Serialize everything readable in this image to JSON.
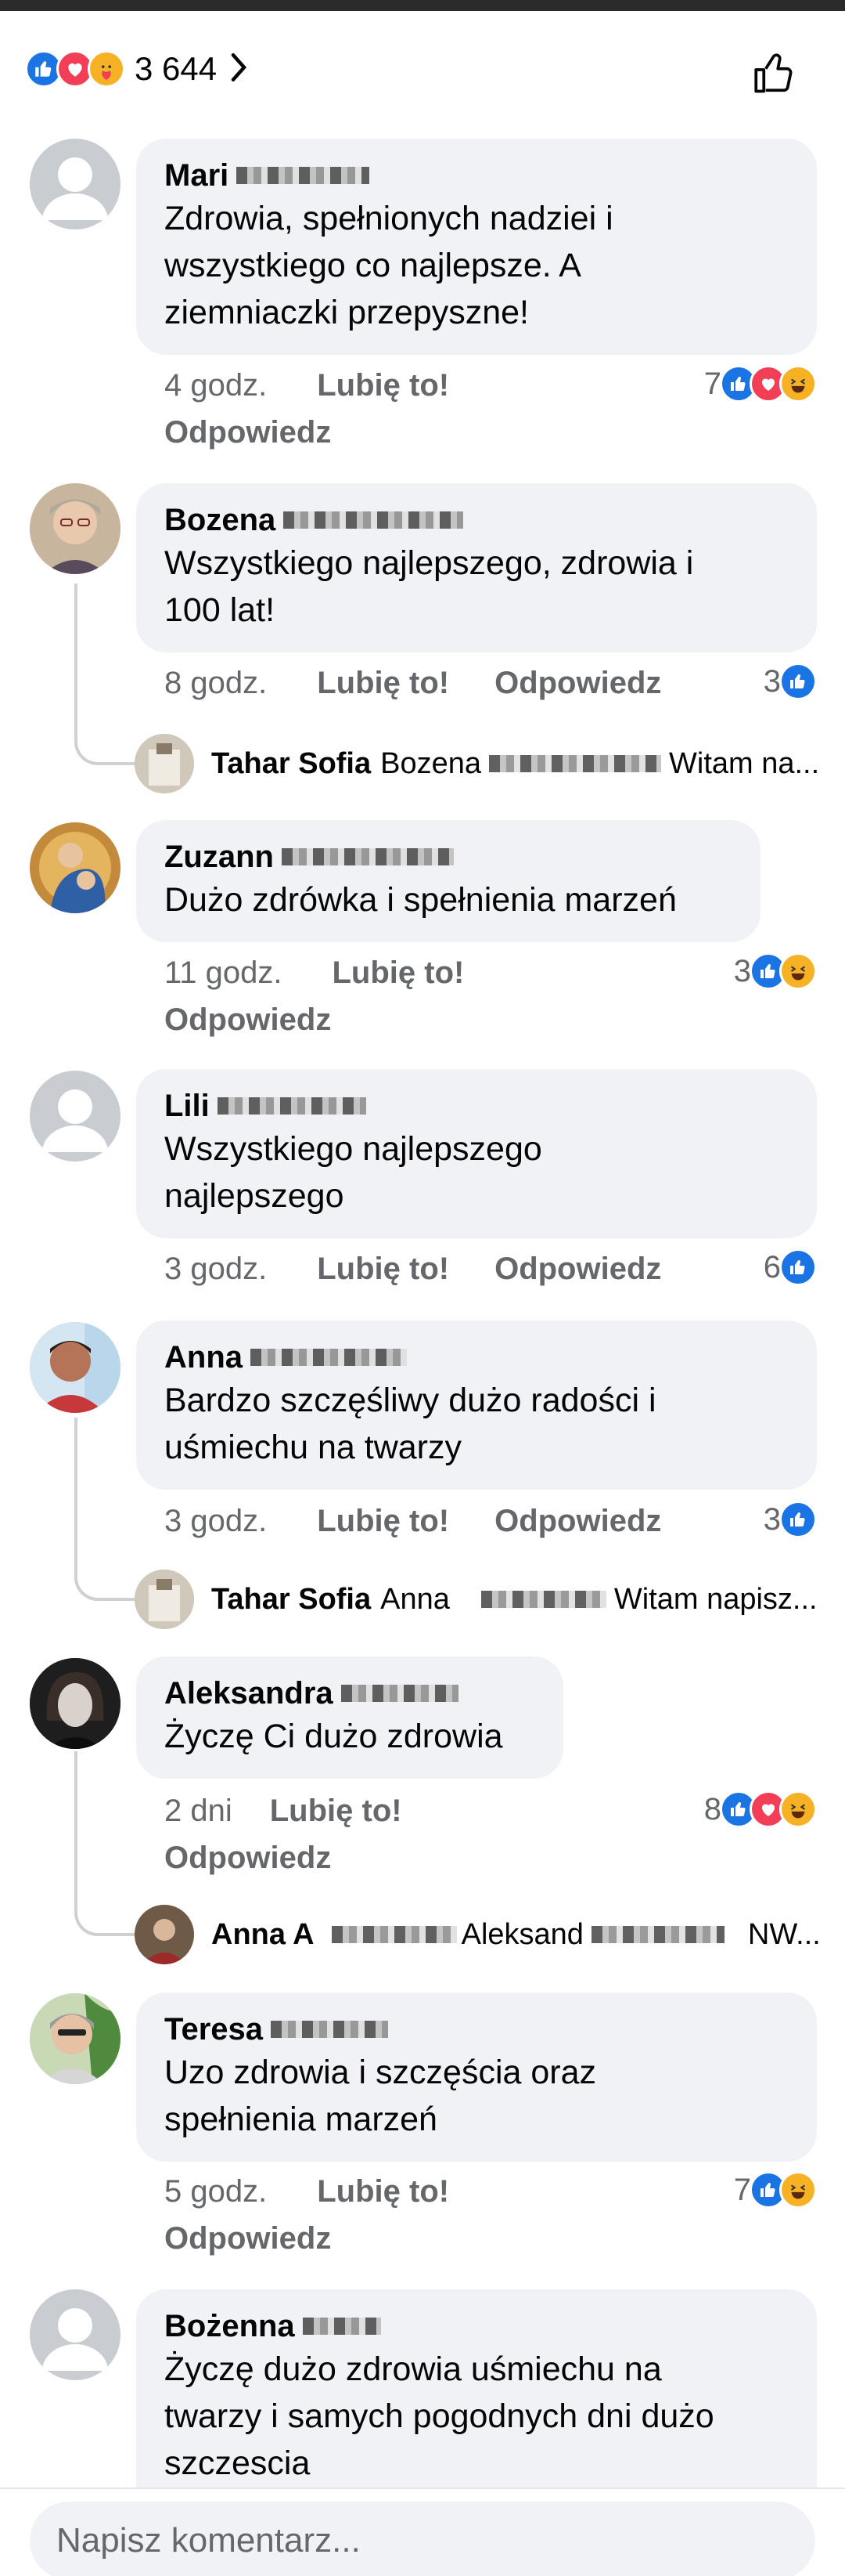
{
  "header": {
    "reaction_count": "3 644",
    "reaction_icons": [
      "like-icon",
      "love-icon",
      "care-icon"
    ]
  },
  "comments": [
    {
      "author": "Mari",
      "text_lines": [
        "Zdrowia, spełnionych nadziei i",
        "wszystkiego co najlepsze. A",
        "ziemniaczki przepyszne!"
      ],
      "time": "4 godz.",
      "like": "Lubię to!",
      "reply": "Odpowiedz",
      "reaction_count": "7",
      "reactions": [
        "like-icon",
        "love-icon",
        "haha-icon"
      ]
    },
    {
      "author": "Bozena",
      "text_lines": [
        "Wszystkiego najlepszego, zdrowia i",
        "100 lat!"
      ],
      "time": "8 godz.",
      "like": "Lubię to!",
      "reply": "Odpowiedz",
      "reaction_count": "3",
      "reactions": [
        "like-icon"
      ]
    },
    {
      "author": "Zuzann",
      "text_lines": [
        "Dużo zdrówka i spełnienia marzeń"
      ],
      "time": "11 godz.",
      "like": "Lubię to!",
      "reply": "Odpowiedz",
      "reaction_count": "3",
      "reactions": [
        "like-icon",
        "haha-icon"
      ]
    },
    {
      "author": "Lili",
      "text_lines": [
        "Wszystkiego najlepszego",
        "najlepszego"
      ],
      "time": "3 godz.",
      "like": "Lubię to!",
      "reply": "Odpowiedz",
      "reaction_count": "6",
      "reactions": [
        "like-icon"
      ]
    },
    {
      "author": "Anna",
      "text_lines": [
        "Bardzo szczęśliwy dużo radości i",
        "uśmiechu  na twarzy"
      ],
      "time": "3 godz.",
      "like": "Lubię to!",
      "reply": "Odpowiedz",
      "reaction_count": "3",
      "reactions": [
        "like-icon"
      ]
    },
    {
      "author": "Aleksandra",
      "text_lines": [
        "Życzę Ci dużo zdrowia"
      ],
      "time": "2 dni",
      "like": "Lubię to!",
      "reply": "Odpowiedz",
      "reaction_count": "8",
      "reactions": [
        "like-icon",
        "love-icon",
        "haha-icon"
      ]
    },
    {
      "author": "Teresa",
      "text_lines": [
        "Uzo zdrowia i szczęścia oraz",
        "spełnienia marzeń"
      ],
      "time": "5 godz.",
      "like": "Lubię to!",
      "reply": "Odpowiedz",
      "reaction_count": "7",
      "reactions": [
        "like-icon",
        "haha-icon"
      ]
    },
    {
      "author": "Bożenna",
      "text_lines": [
        "Życzę dużo zdrowia uśmiechu na",
        "twarzy i samych pogodnych dni dużo",
        "szczescia"
      ]
    }
  ],
  "replies": [
    {
      "author": "Tahar Sofia",
      "mention": "Bozena",
      "snippet": "Witam na..."
    },
    {
      "author": "Tahar Sofia",
      "mention": "Anna",
      "snippet": "Witam napisz..."
    },
    {
      "author": "Anna A",
      "mention": "Aleksand",
      "snippet": "NW..."
    }
  ],
  "composer": {
    "placeholder": "Napisz komentarz..."
  },
  "colors": {
    "like": "#1b74e4",
    "love": "#f33e58",
    "haha": "#f7b125",
    "bubble": "#f0f2f5",
    "meta_text": "#65676b"
  }
}
